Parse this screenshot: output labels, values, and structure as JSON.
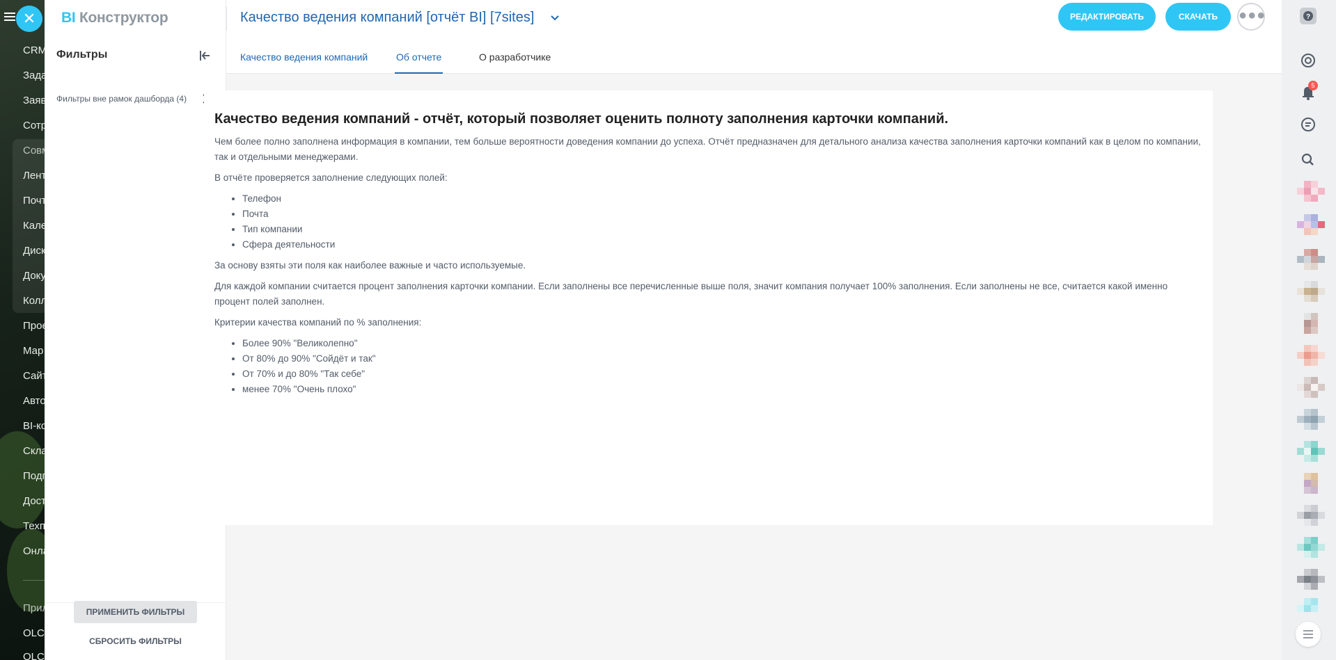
{
  "bg_nav": {
    "items": [
      "CRM",
      "Зада",
      "Заяв",
      "Сотр",
      "Совм",
      "Лент",
      "Почт",
      "Кале",
      "Диск",
      "Доку",
      "Колл",
      "Прое",
      "Мар",
      "Сайт",
      "Авто",
      "BI-ко",
      "Скла",
      "Подп",
      "Дост",
      "Техп",
      "Онла",
      "Прил",
      "OLCF",
      "OLCF"
    ]
  },
  "logo": {
    "bi": "BI",
    "rest": "Конструктор"
  },
  "filters": {
    "title": "Фильтры",
    "outside_label": "Фильтры вне рамок дашборда (4)",
    "apply": "ПРИМЕНИТЬ ФИЛЬТРЫ",
    "reset": "СБРОСИТЬ ФИЛЬТРЫ"
  },
  "header": {
    "title": "Качество ведения компаний [отчёт BI] [7sites]",
    "edit": "РЕДАКТИРОВАТЬ",
    "download": "СКАЧАТЬ",
    "tabs": [
      "Качество ведения компаний",
      "Об отчете",
      "О разработчике"
    ],
    "active_tab": "Об отчете"
  },
  "content": {
    "heading": "Качество ведения компаний - отчёт, который позволяет оценить полноту заполнения карточки компаний.",
    "p1": "Чем более полно заполнена информация в компании, тем больше вероятности доведения компании до успеха. Отчёт предназначен для детального анализа качества заполнения карточки компаний как в целом по компании, так и отдельными менеджерами.",
    "p2": "В отчёте проверяется заполнение следующих полей:",
    "fields": [
      "Телефон",
      "Почта",
      "Тип компании",
      "Сфера деятельности"
    ],
    "p3": "За основу взяты эти поля как наиболее важные и часто используемые.",
    "p4": "Для каждой компании считается процент заполнения карточки компании. Если заполнены все перечисленные выше поля, значит компания получает 100% заполнения. Если заполнены не все, считается какой именно процент полей заполнен.",
    "p5": "Критерии качества компаний по % заполнения:",
    "criteria": [
      "Более 90% \"Великолепно\"",
      "От 80% до 90% \"Сойдёт и так\"",
      "От 70% и до 80% \"Так себе\"",
      "менее 70% \"Очень плохо\""
    ]
  },
  "right_bar": {
    "notifications_count": "5"
  },
  "colors": {
    "accent": "#2fc6f6",
    "link": "#2067b0",
    "badge": "#ff5752"
  }
}
